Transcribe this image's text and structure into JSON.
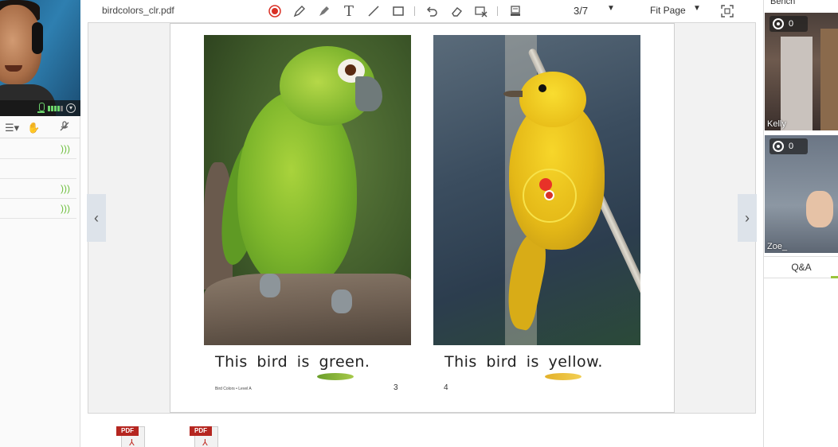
{
  "document": {
    "filename": "birdcolors_clr.pdf",
    "page_indicator": "3/7",
    "zoom": "Fit Page"
  },
  "toolbar_icons": [
    "record-icon",
    "pencil-icon",
    "highlighter-icon",
    "text-icon",
    "line-icon",
    "rectangle-icon",
    "undo-icon",
    "eraser-icon",
    "clear-icon",
    "stamp-icon",
    "fit-screen-icon"
  ],
  "page": {
    "caption_left": "This bird is green.",
    "caption_right": "This bird is yellow.",
    "footer_left": "Bird Colors • Level A",
    "page_left": "3",
    "page_right": "4"
  },
  "files": [
    {
      "tag": "PDF"
    },
    {
      "tag": "PDF"
    }
  ],
  "right_panel": {
    "title": "Bench",
    "students": [
      {
        "name": "Kelly",
        "stars": "0"
      },
      {
        "name": "Zoe_",
        "stars": "0"
      }
    ],
    "qa_tab": "Q&A"
  },
  "colors": {
    "annotation_red": "#e83228",
    "annotation_yellow": "#f7e24a",
    "mic_green": "#6cd46c",
    "pdf_red": "#b52620"
  }
}
